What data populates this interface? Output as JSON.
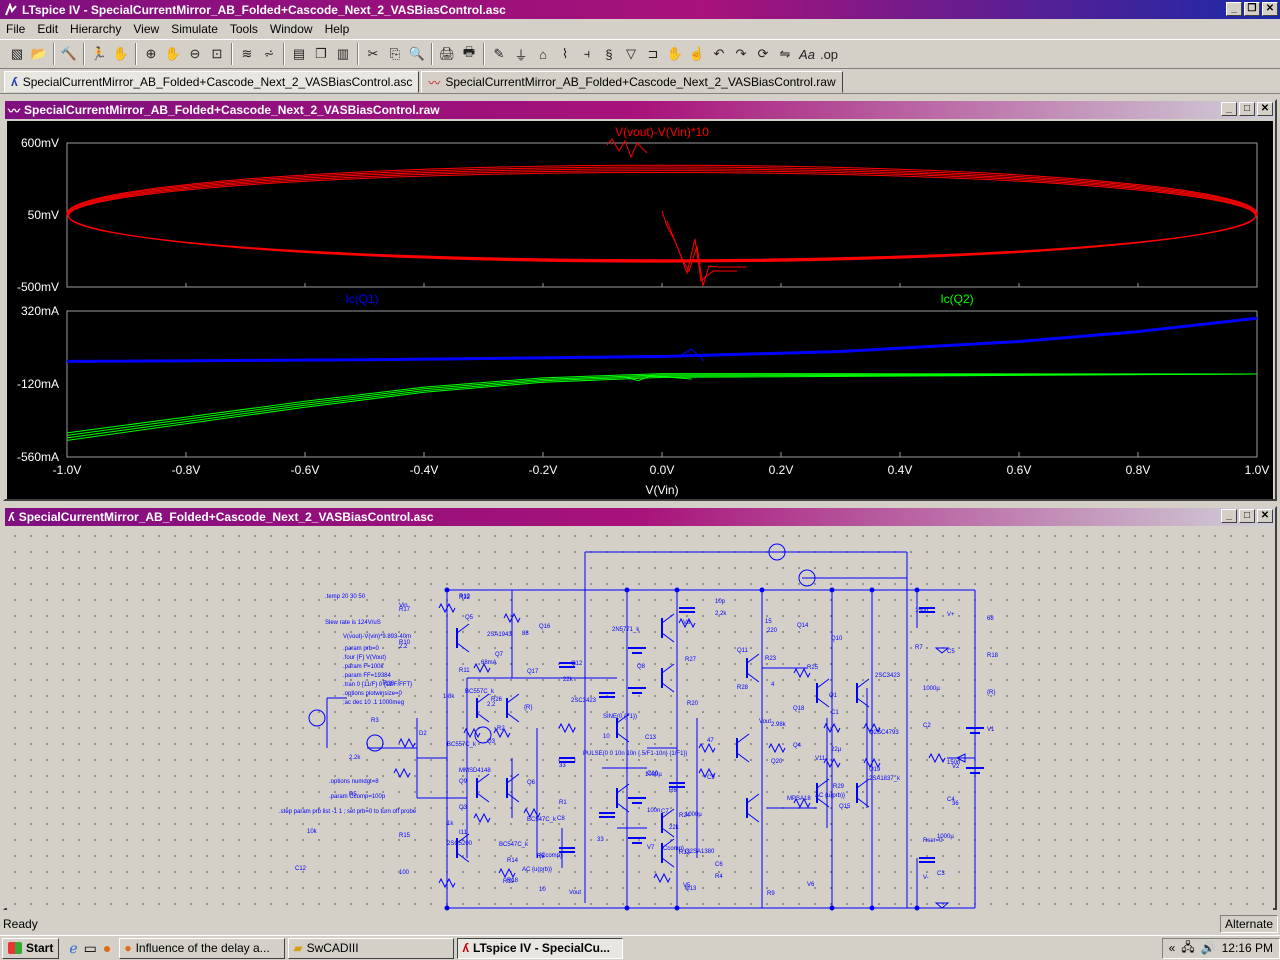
{
  "app": {
    "title": "LTspice IV - SpecialCurrentMirror_AB_Folded+Cascode_Next_2_VASBiasControl.asc"
  },
  "menu": [
    "File",
    "Edit",
    "Hierarchy",
    "View",
    "Simulate",
    "Tools",
    "Window",
    "Help"
  ],
  "tabs": [
    {
      "label": "SpecialCurrentMirror_AB_Folded+Cascode_Next_2_VASBiasControl.asc"
    },
    {
      "label": "SpecialCurrentMirror_AB_Folded+Cascode_Next_2_VASBiasControl.raw"
    }
  ],
  "wave_window": {
    "title": "SpecialCurrentMirror_AB_Folded+Cascode_Next_2_VASBiasControl.raw"
  },
  "schem_window": {
    "title": "SpecialCurrentMirror_AB_Folded+Cascode_Next_2_VASBiasControl.asc"
  },
  "chart_data": [
    {
      "type": "line",
      "title": "",
      "series": [
        {
          "name": "V(vout)-V(Vin)*10",
          "color": "#ff0000",
          "shape": "ellipse-loop",
          "x_range": [
            -1.0,
            1.0
          ],
          "y_range": [
            -0.25,
            0.45
          ]
        }
      ],
      "yticks": [
        "600mV",
        "50mV",
        "-500mV"
      ],
      "ylim": [
        -0.5,
        0.6
      ],
      "xlim": [
        -1.0,
        1.0
      ],
      "grid": false
    },
    {
      "type": "line",
      "title": "",
      "series": [
        {
          "name": "Ic(Q1)",
          "color": "#0000ff",
          "x": [
            -1.0,
            -0.5,
            0.0,
            0.3,
            0.6,
            0.8,
            1.0
          ],
          "y": [
            0.01,
            0.02,
            0.04,
            0.07,
            0.13,
            0.19,
            0.27
          ]
        },
        {
          "name": "Ic(Q2)",
          "color": "#00ff00",
          "x": [
            -1.0,
            -0.8,
            -0.6,
            -0.4,
            -0.2,
            0.0,
            0.5,
            1.0
          ],
          "y": [
            -0.46,
            -0.36,
            -0.26,
            -0.17,
            -0.11,
            -0.08,
            -0.07,
            -0.06
          ]
        }
      ],
      "yticks": [
        "320mA",
        "-120mA",
        "-560mA"
      ],
      "ylim": [
        -0.56,
        0.32
      ],
      "xticks": [
        "-1.0V",
        "-0.8V",
        "-0.6V",
        "-0.4V",
        "-0.2V",
        "0.0V",
        "0.2V",
        "0.4V",
        "0.6V",
        "0.8V",
        "1.0V"
      ],
      "xlim": [
        -1.0,
        1.0
      ],
      "xlabel": "V(Vin)",
      "grid": false
    }
  ],
  "schematic": {
    "directives": [
      ".temp 20 30 50",
      "Slew rate is 124V/uS",
      "V(vout)-V(vin)*9.893-40m",
      ".param prb=0",
      ".four {F} V(Vout)",
      ".param F=100k",
      ".param FF=19384",
      ".tran 0 {11/F} 0 {11/F/FFT}",
      ".options plotwinsize=0",
      ";ac dec 10 .1 1000meg",
      ".options numdgt=8",
      ".param Ccomp=100p",
      ".step param prb list -1 1 ; set prb=0 to turn off probe"
    ],
    "labels": [
      "R12",
      "88",
      "R11",
      "{R}",
      "BC557C_k",
      "Q9",
      "C8",
      "{Ccomp}",
      "Vout",
      "2N5771_k",
      "Q8",
      "R20",
      "47",
      "C9",
      "1000µ",
      "Q2SA1380",
      "Q13",
      "Q14",
      "68mA",
      "R26",
      "10",
      "C10",
      "100n",
      "V7",
      "V6",
      "15",
      "R23",
      "Q1",
      "Q2SC4793",
      "Q19",
      "Q15",
      "2SC5200",
      "R18",
      "Q5",
      "Q7",
      "BC557C_k",
      "R2",
      "33",
      "R1",
      "33",
      "R4",
      "2.2k",
      "Q11",
      "R28",
      "2.98k",
      "Q20",
      "MPSA18",
      "R15",
      "100",
      "R17",
      "2.2",
      "R16",
      "R3",
      "2.2k",
      "R5",
      "10k",
      "C12",
      "Vin",
      "R10",
      "22k",
      "SINE(0 {F1})",
      "PULSE(0 0 10n 10n {.5/F1-10n} {1/F1})",
      "R6",
      "22k",
      "C6",
      "10p",
      "Q10",
      "2SC3423",
      "C1",
      "22µ",
      "R29",
      "1k",
      "R14",
      "R22",
      "2SA1943",
      "Q17",
      "Q18",
      "Q4",
      "Q6",
      "BC547C_k",
      "R8",
      "R9",
      "220",
      "R25",
      "2.2",
      "Q3",
      "2SA1837_k",
      "R24",
      "R13",
      "10",
      "Q16",
      "Q12",
      "2SC3423",
      "C13",
      "1000µ",
      "C7",
      "{Ccomp}",
      "V5",
      "V8",
      "R27",
      "1.8k",
      "D2",
      "MMSD4148",
      "Q3",
      "BC547C_k",
      "R19",
      "68",
      "R18",
      "{R}",
      "V1",
      "V2",
      "36",
      "Rser=0",
      "V-",
      "V+",
      "C5",
      "1000µ",
      "C2",
      "150n",
      "C4",
      "1000µ",
      "C3",
      "150n",
      "R7",
      "4",
      "Vout",
      "V11",
      "AC {u(prb)}",
      "I11",
      "AC {u(prb)}"
    ]
  },
  "status": {
    "ready": "Ready",
    "mode": "Alternate"
  },
  "taskbar": {
    "start": "Start",
    "items": [
      {
        "label": "Influence of the delay a..."
      },
      {
        "label": "SwCADIII"
      },
      {
        "label": "LTspice IV - SpecialCu..."
      }
    ],
    "clock": "12:16 PM"
  }
}
